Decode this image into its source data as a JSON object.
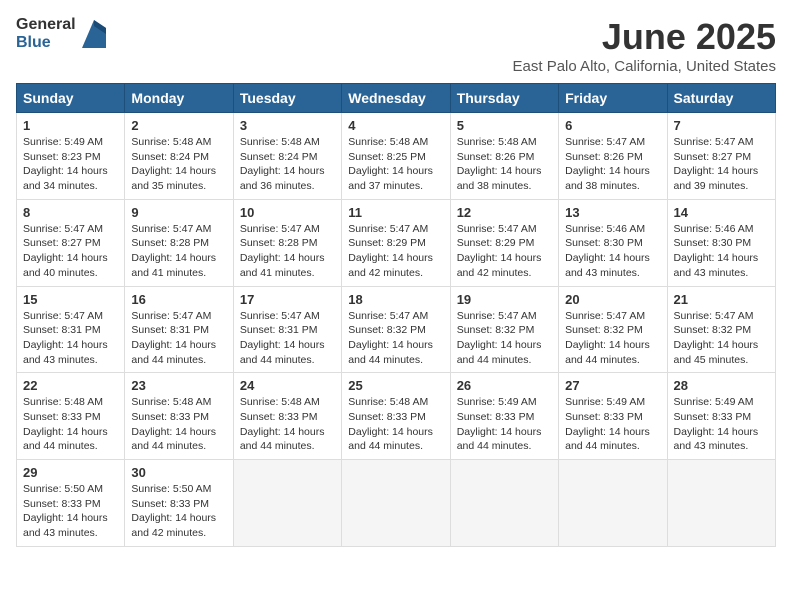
{
  "header": {
    "logo_line1": "General",
    "logo_line2": "Blue",
    "title": "June 2025",
    "subtitle": "East Palo Alto, California, United States"
  },
  "days_of_week": [
    "Sunday",
    "Monday",
    "Tuesday",
    "Wednesday",
    "Thursday",
    "Friday",
    "Saturday"
  ],
  "weeks": [
    [
      {
        "day": "1",
        "info": "Sunrise: 5:49 AM\nSunset: 8:23 PM\nDaylight: 14 hours\nand 34 minutes."
      },
      {
        "day": "2",
        "info": "Sunrise: 5:48 AM\nSunset: 8:24 PM\nDaylight: 14 hours\nand 35 minutes."
      },
      {
        "day": "3",
        "info": "Sunrise: 5:48 AM\nSunset: 8:24 PM\nDaylight: 14 hours\nand 36 minutes."
      },
      {
        "day": "4",
        "info": "Sunrise: 5:48 AM\nSunset: 8:25 PM\nDaylight: 14 hours\nand 37 minutes."
      },
      {
        "day": "5",
        "info": "Sunrise: 5:48 AM\nSunset: 8:26 PM\nDaylight: 14 hours\nand 38 minutes."
      },
      {
        "day": "6",
        "info": "Sunrise: 5:47 AM\nSunset: 8:26 PM\nDaylight: 14 hours\nand 38 minutes."
      },
      {
        "day": "7",
        "info": "Sunrise: 5:47 AM\nSunset: 8:27 PM\nDaylight: 14 hours\nand 39 minutes."
      }
    ],
    [
      {
        "day": "8",
        "info": "Sunrise: 5:47 AM\nSunset: 8:27 PM\nDaylight: 14 hours\nand 40 minutes."
      },
      {
        "day": "9",
        "info": "Sunrise: 5:47 AM\nSunset: 8:28 PM\nDaylight: 14 hours\nand 41 minutes."
      },
      {
        "day": "10",
        "info": "Sunrise: 5:47 AM\nSunset: 8:28 PM\nDaylight: 14 hours\nand 41 minutes."
      },
      {
        "day": "11",
        "info": "Sunrise: 5:47 AM\nSunset: 8:29 PM\nDaylight: 14 hours\nand 42 minutes."
      },
      {
        "day": "12",
        "info": "Sunrise: 5:47 AM\nSunset: 8:29 PM\nDaylight: 14 hours\nand 42 minutes."
      },
      {
        "day": "13",
        "info": "Sunrise: 5:46 AM\nSunset: 8:30 PM\nDaylight: 14 hours\nand 43 minutes."
      },
      {
        "day": "14",
        "info": "Sunrise: 5:46 AM\nSunset: 8:30 PM\nDaylight: 14 hours\nand 43 minutes."
      }
    ],
    [
      {
        "day": "15",
        "info": "Sunrise: 5:47 AM\nSunset: 8:31 PM\nDaylight: 14 hours\nand 43 minutes."
      },
      {
        "day": "16",
        "info": "Sunrise: 5:47 AM\nSunset: 8:31 PM\nDaylight: 14 hours\nand 44 minutes."
      },
      {
        "day": "17",
        "info": "Sunrise: 5:47 AM\nSunset: 8:31 PM\nDaylight: 14 hours\nand 44 minutes."
      },
      {
        "day": "18",
        "info": "Sunrise: 5:47 AM\nSunset: 8:32 PM\nDaylight: 14 hours\nand 44 minutes."
      },
      {
        "day": "19",
        "info": "Sunrise: 5:47 AM\nSunset: 8:32 PM\nDaylight: 14 hours\nand 44 minutes."
      },
      {
        "day": "20",
        "info": "Sunrise: 5:47 AM\nSunset: 8:32 PM\nDaylight: 14 hours\nand 44 minutes."
      },
      {
        "day": "21",
        "info": "Sunrise: 5:47 AM\nSunset: 8:32 PM\nDaylight: 14 hours\nand 45 minutes."
      }
    ],
    [
      {
        "day": "22",
        "info": "Sunrise: 5:48 AM\nSunset: 8:33 PM\nDaylight: 14 hours\nand 44 minutes."
      },
      {
        "day": "23",
        "info": "Sunrise: 5:48 AM\nSunset: 8:33 PM\nDaylight: 14 hours\nand 44 minutes."
      },
      {
        "day": "24",
        "info": "Sunrise: 5:48 AM\nSunset: 8:33 PM\nDaylight: 14 hours\nand 44 minutes."
      },
      {
        "day": "25",
        "info": "Sunrise: 5:48 AM\nSunset: 8:33 PM\nDaylight: 14 hours\nand 44 minutes."
      },
      {
        "day": "26",
        "info": "Sunrise: 5:49 AM\nSunset: 8:33 PM\nDaylight: 14 hours\nand 44 minutes."
      },
      {
        "day": "27",
        "info": "Sunrise: 5:49 AM\nSunset: 8:33 PM\nDaylight: 14 hours\nand 44 minutes."
      },
      {
        "day": "28",
        "info": "Sunrise: 5:49 AM\nSunset: 8:33 PM\nDaylight: 14 hours\nand 43 minutes."
      }
    ],
    [
      {
        "day": "29",
        "info": "Sunrise: 5:50 AM\nSunset: 8:33 PM\nDaylight: 14 hours\nand 43 minutes."
      },
      {
        "day": "30",
        "info": "Sunrise: 5:50 AM\nSunset: 8:33 PM\nDaylight: 14 hours\nand 42 minutes."
      },
      {
        "day": "",
        "info": ""
      },
      {
        "day": "",
        "info": ""
      },
      {
        "day": "",
        "info": ""
      },
      {
        "day": "",
        "info": ""
      },
      {
        "day": "",
        "info": ""
      }
    ]
  ]
}
